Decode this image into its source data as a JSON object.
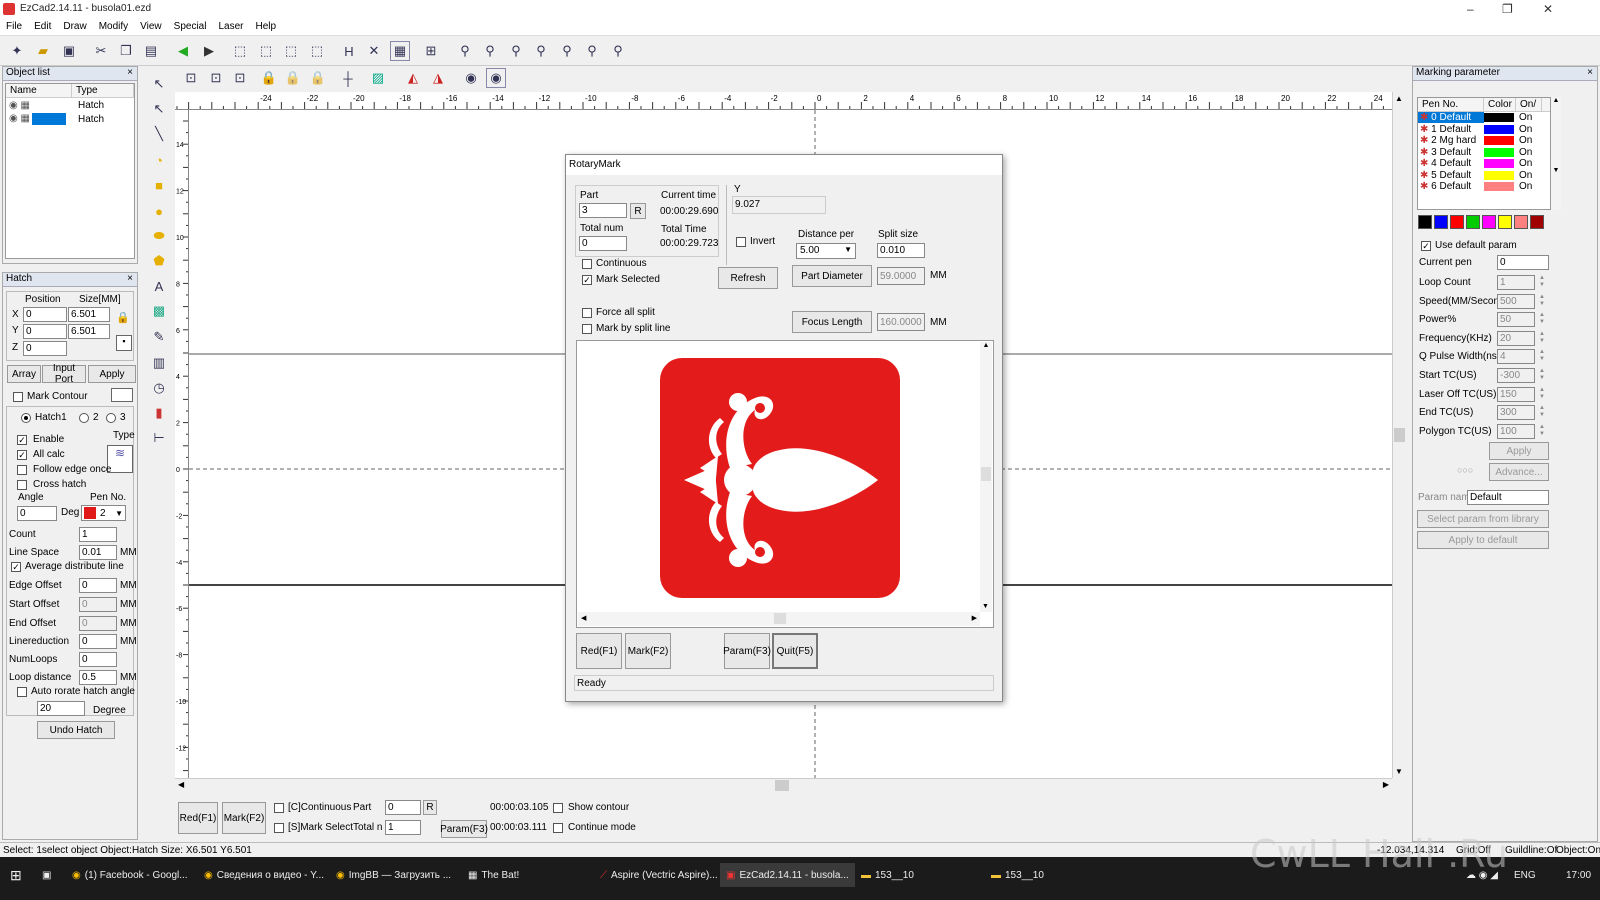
{
  "window": {
    "title": "EzCad2.14.11 - busola01.ezd",
    "controls": [
      "–",
      "❐",
      "✕"
    ]
  },
  "menu": [
    "File",
    "Edit",
    "Draw",
    "Modify",
    "View",
    "Special",
    "Laser",
    "Help"
  ],
  "object_list": {
    "title": "Object list",
    "columns": [
      "Name",
      "Type"
    ],
    "rows": [
      {
        "type": "Hatch"
      },
      {
        "type": "Hatch"
      }
    ]
  },
  "hatch_panel": {
    "title": "Hatch",
    "position_label": "Position",
    "size_label": "Size[MM]",
    "x_label": "X",
    "y_label": "Y",
    "z_label": "Z",
    "x": "0",
    "y": "0",
    "z": "0",
    "size_x": "6.501",
    "size_y": "6.501",
    "buttons": {
      "array": "Array",
      "input_port": "Input Port",
      "apply": "Apply"
    },
    "mark_contour": "Mark Contour",
    "hatch1": "Hatch1",
    "hatch2": "2",
    "hatch3": "3",
    "enable": "Enable",
    "type_label": "Type",
    "all_calc": "All calc",
    "follow_edge": "Follow edge once",
    "cross_hatch": "Cross hatch",
    "angle_label": "Angle",
    "angle": "0",
    "deg": "Deg",
    "pen_no_label": "Pen No.",
    "pen_no": "2",
    "count_label": "Count",
    "count": "1",
    "line_space_label": "Line Space",
    "line_space": "0.01",
    "mm": "MM",
    "avg_distribute": "Average distribute line",
    "edge_offset_label": "Edge Offset",
    "edge_offset": "0",
    "start_offset_label": "Start Offset",
    "start_offset": "0",
    "end_offset_label": "End Offset",
    "end_offset": "0",
    "linereduction_label": "Linereduction",
    "linereduction": "0",
    "numloops_label": "NumLoops",
    "numloops": "0",
    "loop_distance_label": "Loop distance",
    "loop_distance": "0.5",
    "auto_rotate": "Auto rorate hatch angle",
    "rotate_value": "20",
    "degree": "Degree",
    "undo_hatch": "Undo Hatch",
    "pen_color": "#e11818"
  },
  "ruler_top": [
    "-24",
    "-22",
    "-20",
    "-18",
    "-16",
    "-14",
    "-12",
    "-10",
    "-8",
    "-6",
    "-4",
    "-2",
    "0",
    "2",
    "4",
    "6",
    "8",
    "10",
    "12",
    "14",
    "16",
    "18",
    "20",
    "22",
    "24"
  ],
  "ruler_left": [
    "14",
    "12",
    "10",
    "8",
    "6",
    "4",
    "2",
    "0",
    "-2",
    "-4",
    "-6",
    "-8",
    "-10",
    "-12"
  ],
  "rotary_mark": {
    "title": "RotaryMark",
    "part_label": "Part",
    "part": "3",
    "r_button": "R",
    "total_num_label": "Total num",
    "total_num": "0",
    "current_time_label": "Current time",
    "current_time": "00:00:29.690",
    "total_time_label": "Total Time",
    "total_time": "00:00:29.723",
    "y_label": "Y",
    "y_value": "9.027",
    "invert": "Invert",
    "distance_per_label": "Distance per",
    "distance_per": "5.00",
    "split_size_label": "Split size",
    "split_size": "0.010",
    "continuous": "Continuous",
    "mark_selected": "Mark Selected",
    "refresh": "Refresh",
    "part_diameter": "Part Diameter",
    "part_diameter_value": "59.0000",
    "mm": "MM",
    "force_all_split": "Force all split",
    "mark_by_split_line": "Mark by split line",
    "focus_length": "Focus Length",
    "focus_length_value": "160.0000",
    "red_button": "Red(F1)",
    "mark_button": "Mark(F2)",
    "param_button": "Param(F3)",
    "quit_button": "Quit(F5)",
    "status": "Ready",
    "logo_color": "#e41b1b"
  },
  "bottom_bar": {
    "red": "Red(F1)",
    "mark": "Mark(F2)",
    "continuous": "[C]Continuous",
    "mark_select": "[S]Mark Select",
    "part_label": "Part",
    "part": "0",
    "r": "R",
    "total_label": "Total n",
    "total": "1",
    "param": "Param(F3)",
    "time1": "00:00:03.105",
    "time2": "00:00:03.111",
    "show_contour": "Show contour",
    "continue_mode": "Continue mode"
  },
  "marking_param": {
    "title": "Marking parameter",
    "columns": [
      "Pen No.",
      "Color",
      "On/"
    ],
    "pens": [
      {
        "name": "0 Default",
        "color": "#000000",
        "on": "On"
      },
      {
        "name": "1 Default",
        "color": "#0000ff",
        "on": "On"
      },
      {
        "name": "2 Mg hard",
        "color": "#ff0000",
        "on": "On"
      },
      {
        "name": "3 Default",
        "color": "#00ff00",
        "on": "On"
      },
      {
        "name": "4 Default",
        "color": "#ff00ff",
        "on": "On"
      },
      {
        "name": "5 Default",
        "color": "#ffff00",
        "on": "On"
      },
      {
        "name": "6 Default",
        "color": "#ff8080",
        "on": "On"
      }
    ],
    "palette": [
      "#000000",
      "#0000ff",
      "#ff0000",
      "#00cc00",
      "#ff00ff",
      "#ffff00",
      "#ff8080",
      "#a00000"
    ],
    "use_default_param": "Use default param",
    "current_pen_label": "Current pen",
    "current_pen": "0",
    "params": [
      {
        "label": "Loop Count",
        "value": "1"
      },
      {
        "label": "Speed(MM/Secon",
        "value": "500"
      },
      {
        "label": "Power%",
        "value": "50"
      },
      {
        "label": "Frequency(KHz)",
        "value": "20"
      },
      {
        "label": "Q Pulse Width(ns)",
        "value": "4"
      },
      {
        "label": "Start TC(US)",
        "value": "-300"
      },
      {
        "label": "Laser Off TC(US)",
        "value": "150"
      },
      {
        "label": "End TC(US)",
        "value": "300"
      },
      {
        "label": "Polygon TC(US)",
        "value": "100"
      }
    ],
    "apply": "Apply",
    "advance": "Advance...",
    "param_name_label": "Param name",
    "param_name": "Default",
    "select_param": "Select param from library",
    "apply_default": "Apply to default"
  },
  "status_bar": {
    "text": "Select: 1select object Object:Hatch Size: X6.501 Y6.501",
    "coords": "-12.034,14.314",
    "grid": "Grid:Off",
    "guideline": "Guildline:Of",
    "object": "Object:On"
  },
  "taskbar": {
    "items": [
      {
        "label": "(1) Facebook - Googl..."
      },
      {
        "label": "Сведения о видео - Y..."
      },
      {
        "label": "ImgBB — Загрузить ..."
      },
      {
        "label": "The Bat!"
      },
      {
        "label": "Aspire (Vectric Aspire)..."
      },
      {
        "label": "EzCad2.14.11 - busola..."
      },
      {
        "label": "153__10"
      },
      {
        "label": "153__10"
      }
    ],
    "lang": "ENG",
    "time": "17:00"
  },
  "watermark": "CwLL Hall .Ru"
}
